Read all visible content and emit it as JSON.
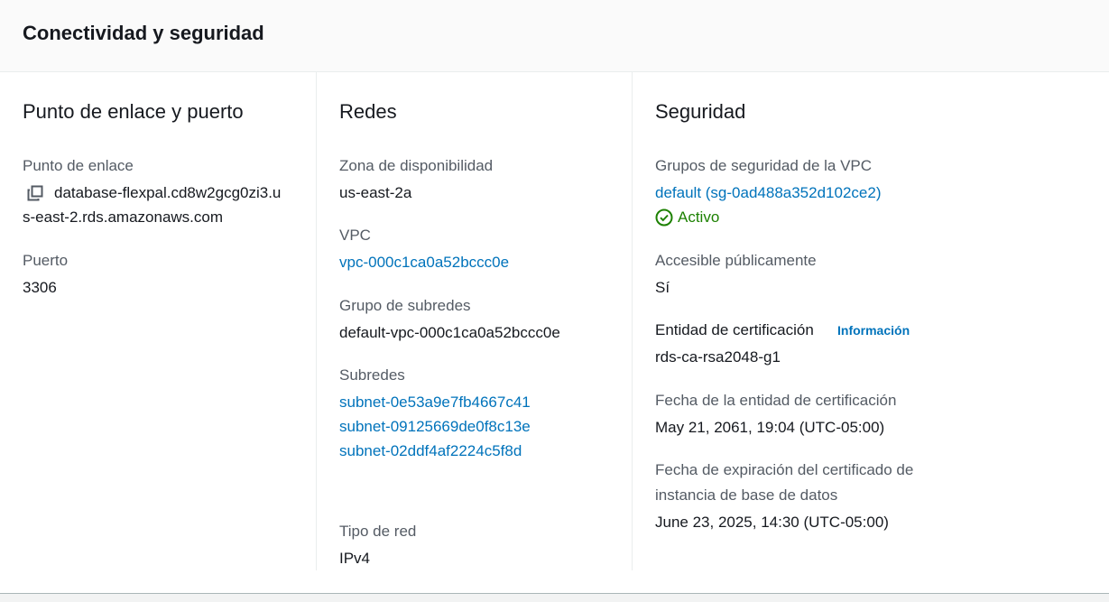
{
  "panel": {
    "title": "Conectividad y seguridad"
  },
  "endpoint": {
    "title": "Punto de enlace y puerto",
    "endpoint_label": "Punto de enlace",
    "endpoint_line1": "database-flexpal.cd8w2gcg0zi3.u",
    "endpoint_line2": "s-east-2.rds.amazonaws.com",
    "port_label": "Puerto",
    "port_value": "3306",
    "copy_icon": "copy-icon"
  },
  "networking": {
    "title": "Redes",
    "az_label": "Zona de disponibilidad",
    "az_value": "us-east-2a",
    "vpc_label": "VPC",
    "vpc_value": "vpc-000c1ca0a52bccc0e",
    "subnet_group_label": "Grupo de subredes",
    "subnet_group_value": "default-vpc-000c1ca0a52bccc0e",
    "subnets_label": "Subredes",
    "subnets": [
      "subnet-0e53a9e7fb4667c41",
      "subnet-09125669de0f8c13e",
      "subnet-02ddf4af2224c5f8d"
    ],
    "network_type_label": "Tipo de red",
    "network_type_value": "IPv4"
  },
  "security": {
    "title": "Seguridad",
    "sg_label": "Grupos de seguridad de la VPC",
    "sg_value": "default (sg-0ad488a352d102ce2)",
    "sg_status": "Activo",
    "sg_status_icon": "check-circle-icon",
    "public_label": "Accesible públicamente",
    "public_value": "Sí",
    "ca_label": "Entidad de certificación",
    "ca_info": "Información",
    "ca_value": "rds-ca-rsa2048-g1",
    "ca_date_label": "Fecha de la entidad de certificación",
    "ca_date_value": "May 21, 2061, 19:04 (UTC-05:00)",
    "cert_exp_label_line1": "Fecha de expiración del certificado de",
    "cert_exp_label_line2": "instancia de base de datos",
    "cert_exp_value": "June 23, 2025, 14:30 (UTC-05:00)"
  },
  "colors": {
    "link": "#0073bb",
    "status_ok": "#1d8102",
    "label": "#545b64",
    "text": "#16191f"
  }
}
